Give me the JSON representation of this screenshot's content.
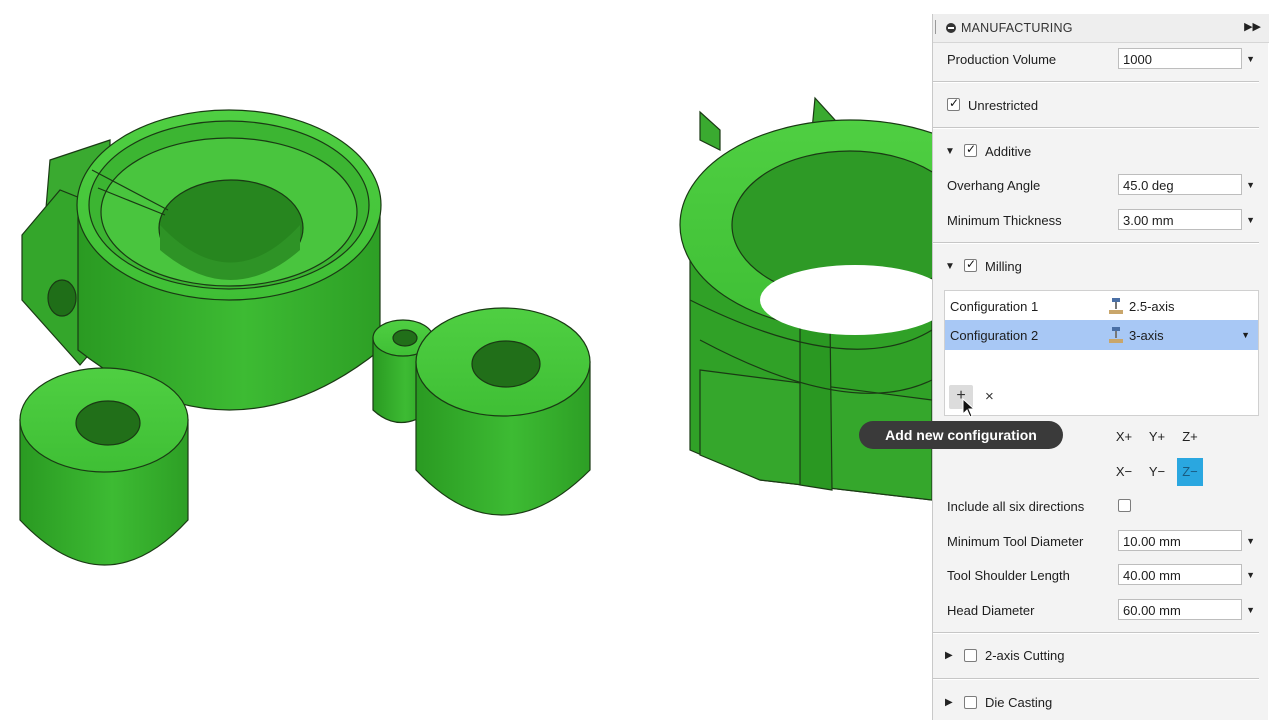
{
  "panel": {
    "title": "MANUFACTURING",
    "production_volume": {
      "label": "Production Volume",
      "value": "1000"
    },
    "unrestricted": {
      "label": "Unrestricted",
      "checked": true
    },
    "additive": {
      "label": "Additive",
      "checked": true,
      "overhang_angle": {
        "label": "Overhang Angle",
        "value": "45.0 deg"
      },
      "minimum_thickness": {
        "label": "Minimum Thickness",
        "value": "3.00 mm"
      }
    },
    "milling": {
      "label": "Milling",
      "checked": true,
      "configurations": [
        {
          "name": "Configuration 1",
          "type": "2.5-axis",
          "selected": false
        },
        {
          "name": "Configuration 2",
          "type": "3-axis",
          "selected": true
        }
      ],
      "add_icon": "+",
      "delete_icon": "×",
      "axes": [
        "X+",
        "Y+",
        "Z+",
        "X−",
        "Y−",
        "Z−"
      ],
      "active_axis": "Z−",
      "include_all_six": {
        "label": "Include all six directions",
        "checked": false
      },
      "minimum_tool_diameter": {
        "label": "Minimum Tool Diameter",
        "value": "10.00 mm"
      },
      "tool_shoulder_length": {
        "label": "Tool Shoulder Length",
        "value": "40.00 mm"
      },
      "head_diameter": {
        "label": "Head Diameter",
        "value": "60.00 mm"
      }
    },
    "two_axis_cutting": {
      "label": "2-axis Cutting",
      "checked": false
    },
    "die_casting": {
      "label": "Die Casting",
      "checked": false
    }
  },
  "tooltip": "Add new configuration",
  "colors": {
    "part_green": "#3cb031",
    "selected_row": "#a8c8f5",
    "active_axis": "#2aa7e0"
  }
}
